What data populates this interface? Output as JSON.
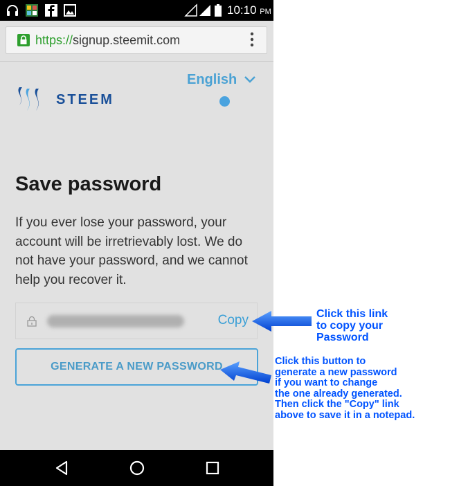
{
  "statusbar": {
    "time": "10:10",
    "ampm": "PM",
    "icons": [
      "headphones-icon",
      "app-icon",
      "facebook-icon",
      "image-icon",
      "signal-icon",
      "signal-icon",
      "battery-icon"
    ]
  },
  "browser": {
    "url_scheme": "https://",
    "url_host": "signup.steemit.com",
    "menu_icon": "menu-dots-icon"
  },
  "header": {
    "language": "English",
    "brand": "STEEM"
  },
  "main": {
    "title": "Save password",
    "description": "If you ever lose your password, your account will be irretrievably lost. We do not have your password, and we cannot help you recover it.",
    "copy_label": "Copy",
    "generate_label": "GENERATE A NEW PASSWORD"
  },
  "annotations": {
    "copy_note_lines": [
      "Click this link",
      "to copy your",
      "Password"
    ],
    "generate_note_lines": [
      "Click this button to",
      "generate a new password",
      "if you want to change",
      "the one already generated.",
      "Then click the \"Copy\" link",
      "above to save it in a notepad."
    ]
  },
  "colors": {
    "accent": "#4aa3d8",
    "brand": "#1a5099",
    "annotation": "#0053ff",
    "secure": "#2e9f2e"
  }
}
